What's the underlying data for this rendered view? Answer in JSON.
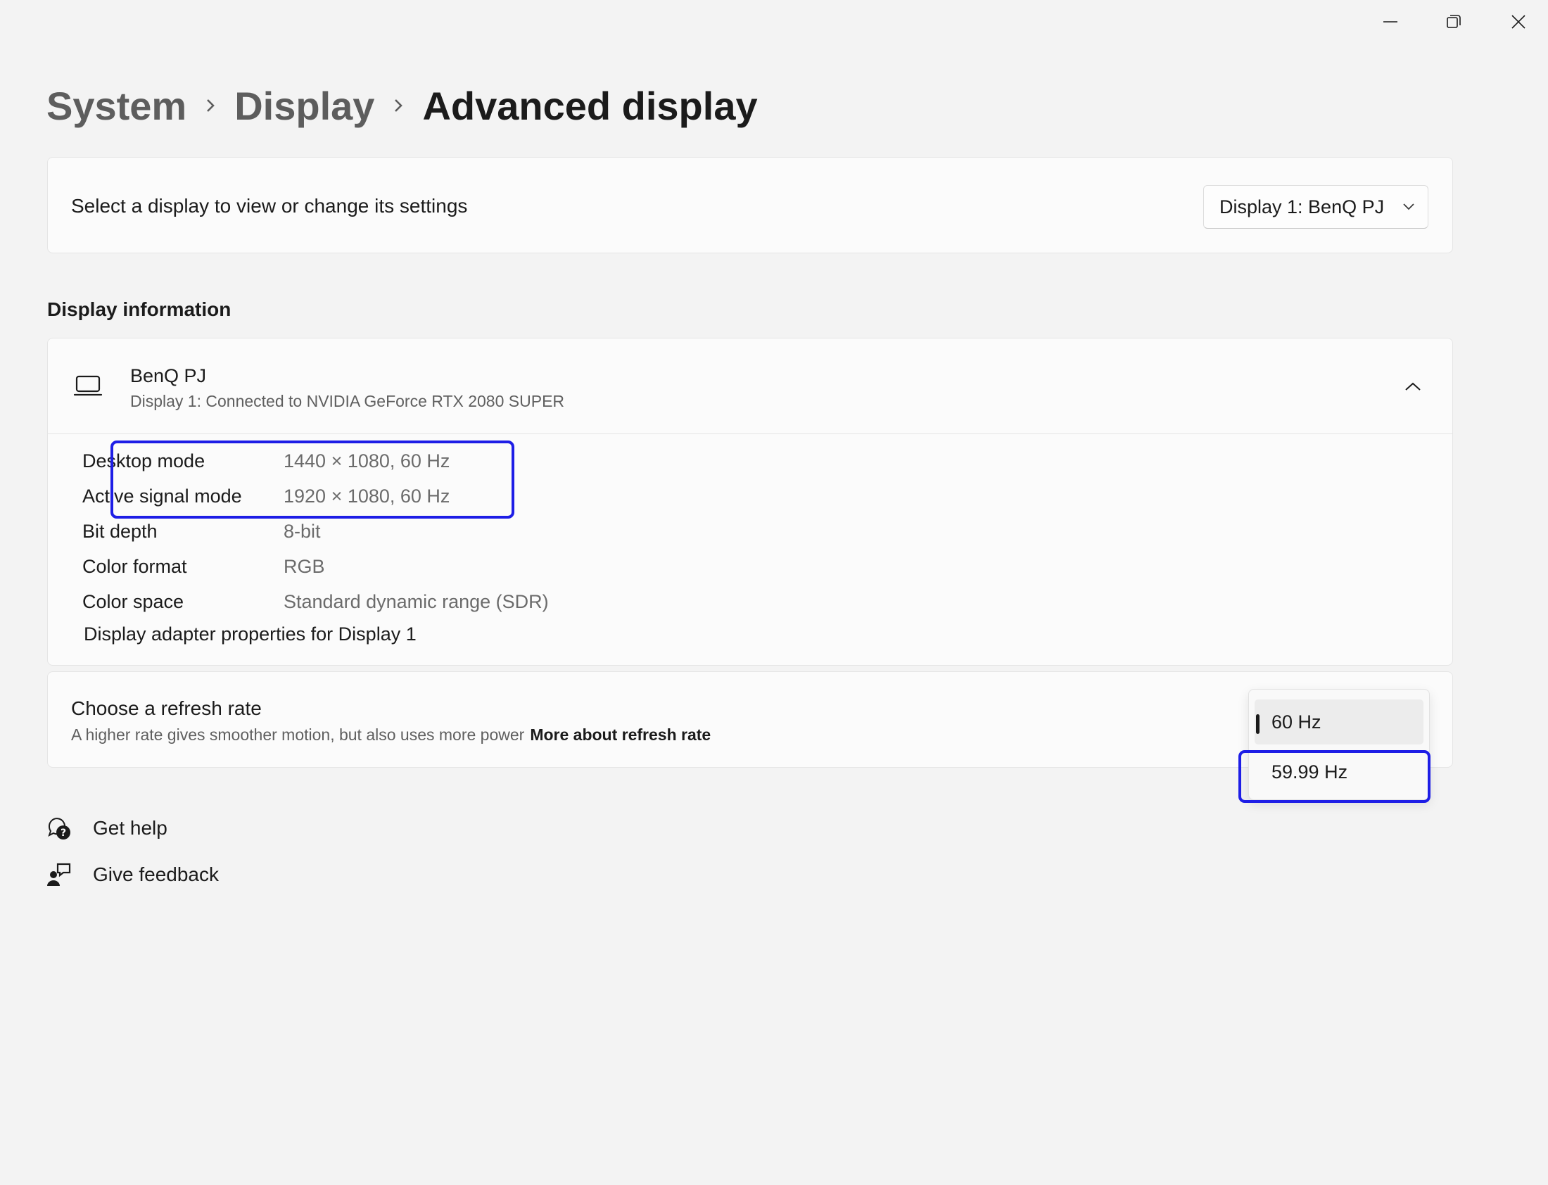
{
  "window": {
    "minimize_icon": "minimize-icon",
    "maximize_icon": "restore-icon",
    "close_icon": "close-icon"
  },
  "breadcrumb": {
    "items": [
      "System",
      "Display",
      "Advanced display"
    ],
    "separator_icon": "chevron-right-icon"
  },
  "display_select": {
    "prompt": "Select a display to view or change its settings",
    "selected": "Display 1: BenQ PJ",
    "chevron_icon": "chevron-down-icon"
  },
  "display_info": {
    "section_title": "Display information",
    "device_name": "BenQ PJ",
    "device_subtitle": "Display 1: Connected to NVIDIA GeForce RTX 2080 SUPER",
    "device_icon": "monitor-icon",
    "collapse_icon": "chevron-up-icon",
    "rows": [
      {
        "label": "Desktop mode",
        "value": "1440 × 1080, 60 Hz"
      },
      {
        "label": "Active signal mode",
        "value": "1920 × 1080, 60 Hz"
      },
      {
        "label": "Bit depth",
        "value": "8-bit"
      },
      {
        "label": "Color format",
        "value": "RGB"
      },
      {
        "label": "Color space",
        "value": "Standard dynamic range (SDR)"
      }
    ],
    "adapter_link": "Display adapter properties for Display 1"
  },
  "refresh_rate": {
    "title": "Choose a refresh rate",
    "description": "A higher rate gives smoother motion, but also uses more power",
    "more_link": "More about refresh rate",
    "options": [
      "60 Hz",
      "59.99 Hz"
    ],
    "selected": "60 Hz"
  },
  "footer_links": [
    {
      "label": "Get help",
      "icon": "get-help-icon"
    },
    {
      "label": "Give feedback",
      "icon": "give-feedback-icon"
    }
  ],
  "colors": {
    "background": "#f3f3f3",
    "card": "#fbfbfb",
    "highlight": "#1e1ee6",
    "text_primary": "#1b1b1b",
    "text_secondary": "#6b6b6b"
  }
}
